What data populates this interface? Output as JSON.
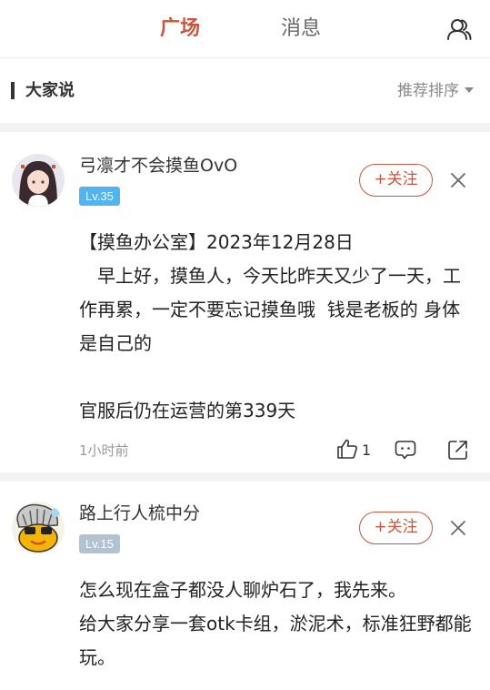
{
  "header": {
    "tabs": [
      "广场",
      "消息"
    ],
    "icon": "people-icon"
  },
  "section": {
    "title": "大家说",
    "sort_label": "推荐排序"
  },
  "posts": [
    {
      "username": "弓凛才不会摸鱼OvO",
      "level": "Lv.35",
      "level_color": "#52b3ee",
      "follow_label": "+关注",
      "text": "【摸鱼办公室】2023年12月28日\n　早上好，摸鱼人，今天比昨天又少了一天，工作再累，一定不要忘记摸鱼哦  钱是老板的 身体是自己的\n\n官服后仍在运营的第339天",
      "time": "1小时前",
      "likes": "1"
    },
    {
      "username": "路上行人梳中分",
      "level": "Lv.15",
      "level_color": "#b3c2d1",
      "follow_label": "+关注",
      "text": "怎么现在盒子都没人聊炉石了，我先来。\n给大家分享一套otk卡组，淤泥术，标准狂野都能玩。"
    }
  ],
  "colors": {
    "accent": "#c8553d",
    "divider": "#f3f3f3"
  }
}
